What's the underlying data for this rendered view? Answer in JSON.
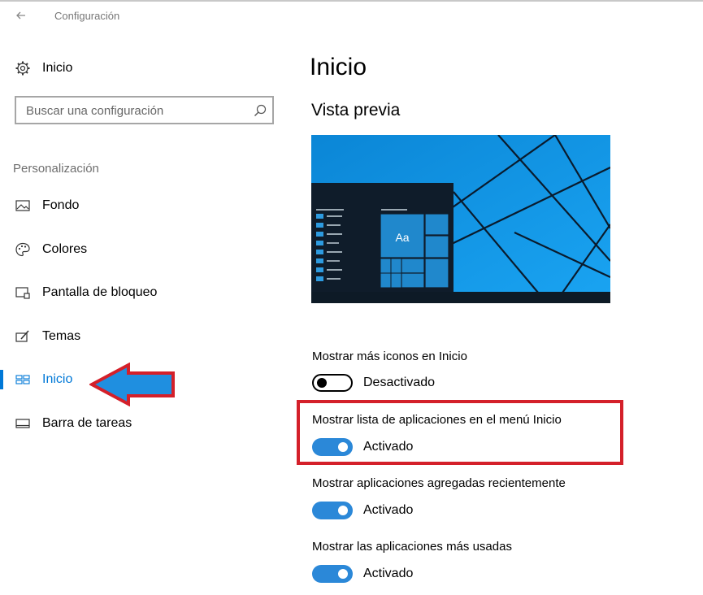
{
  "window": {
    "title": "Configuración"
  },
  "sidebar": {
    "home_label": "Inicio",
    "search_placeholder": "Buscar una configuración",
    "section_label": "Personalización",
    "items": [
      {
        "label": "Fondo",
        "icon": "picture-icon"
      },
      {
        "label": "Colores",
        "icon": "palette-icon"
      },
      {
        "label": "Pantalla de bloqueo",
        "icon": "lock-screen-icon"
      },
      {
        "label": "Temas",
        "icon": "themes-icon"
      },
      {
        "label": "Inicio",
        "icon": "start-tiles-icon",
        "selected": true
      },
      {
        "label": "Barra de tareas",
        "icon": "taskbar-icon"
      }
    ]
  },
  "main": {
    "title": "Inicio",
    "preview_heading": "Vista previa",
    "preview_tile_text": "Aa",
    "settings": [
      {
        "label": "Mostrar más iconos en Inicio",
        "state": "Desactivado",
        "on": false
      },
      {
        "label": "Mostrar lista de aplicaciones en el menú Inicio",
        "state": "Activado",
        "on": true,
        "highlighted": true
      },
      {
        "label": "Mostrar aplicaciones agregadas recientemente",
        "state": "Activado",
        "on": true
      },
      {
        "label": "Mostrar las aplicaciones más usadas",
        "state": "Activado",
        "on": true
      }
    ]
  },
  "colors": {
    "accent": "#0078d7",
    "toggle_on": "#2b88d8",
    "annotation_red": "#d4202a",
    "annotation_arrow_fill": "#1f8fe0"
  }
}
